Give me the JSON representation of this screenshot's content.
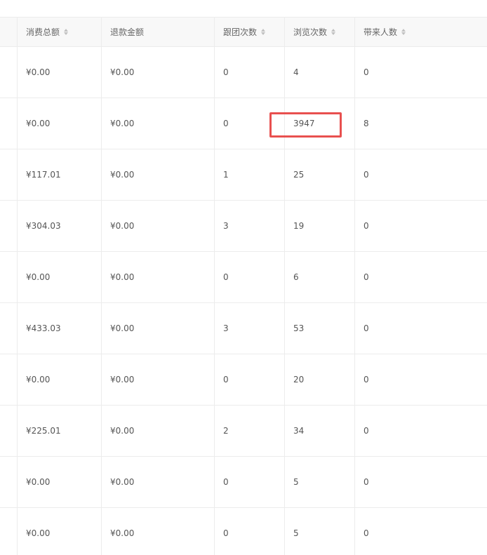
{
  "table": {
    "columns": [
      {
        "label": "消费总额",
        "sortable": true
      },
      {
        "label": "退款金额",
        "sortable": false
      },
      {
        "label": "跟团次数",
        "sortable": true
      },
      {
        "label": "浏览次数",
        "sortable": true
      },
      {
        "label": "带来人数",
        "sortable": true
      }
    ],
    "rows": [
      [
        "¥0.00",
        "¥0.00",
        "0",
        "4",
        "0"
      ],
      [
        "¥0.00",
        "¥0.00",
        "0",
        "3947",
        "8"
      ],
      [
        "¥117.01",
        "¥0.00",
        "1",
        "25",
        "0"
      ],
      [
        "¥304.03",
        "¥0.00",
        "3",
        "19",
        "0"
      ],
      [
        "¥0.00",
        "¥0.00",
        "0",
        "6",
        "0"
      ],
      [
        "¥433.03",
        "¥0.00",
        "3",
        "53",
        "0"
      ],
      [
        "¥0.00",
        "¥0.00",
        "0",
        "20",
        "0"
      ],
      [
        "¥225.01",
        "¥0.00",
        "2",
        "34",
        "0"
      ],
      [
        "¥0.00",
        "¥0.00",
        "0",
        "5",
        "0"
      ],
      [
        "¥0.00",
        "¥0.00",
        "0",
        "5",
        "0"
      ]
    ]
  },
  "annotation": {
    "highlight_color": "#e8504f",
    "highlighted_value": "3947"
  }
}
